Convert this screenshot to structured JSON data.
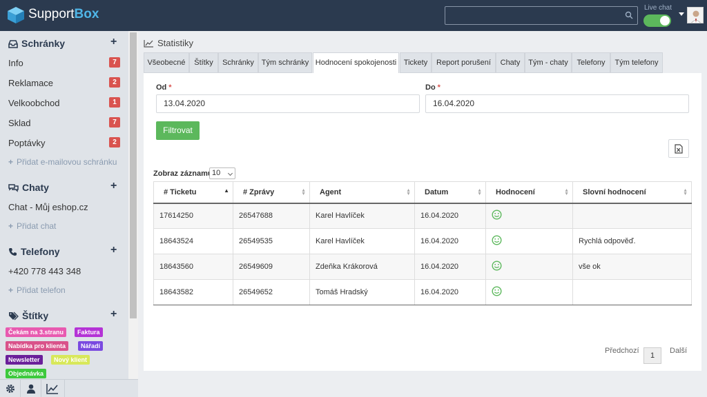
{
  "app": {
    "name_part1": "Support",
    "name_part2": "Box"
  },
  "header": {
    "livechat_label": "Live chat",
    "livechat_on": true,
    "search_placeholder": ""
  },
  "sidebar": {
    "sections": {
      "mailboxes": {
        "title": "Schránky",
        "items": [
          {
            "label": "Info",
            "count": "7"
          },
          {
            "label": "Reklamace",
            "count": "2"
          },
          {
            "label": "Velkoobchod",
            "count": "1"
          },
          {
            "label": "Sklad",
            "count": "7"
          },
          {
            "label": "Poptávky",
            "count": "2"
          }
        ],
        "add_label": "Přidat e-mailovou schránku"
      },
      "chats": {
        "title": "Chaty",
        "items": [
          {
            "label": "Chat - Můj eshop.cz"
          }
        ],
        "add_label": "Přidat chat"
      },
      "phones": {
        "title": "Telefony",
        "items": [
          {
            "label": "+420 778 443 348"
          }
        ],
        "add_label": "Přidat telefon"
      },
      "tags": {
        "title": "Štítky",
        "items": [
          {
            "label": "Čekám na 3.stranu",
            "color": "#e85ab0"
          },
          {
            "label": "Faktura",
            "color": "#b433d6"
          },
          {
            "label": "Nabídka pro klienta",
            "color": "#d9538a"
          },
          {
            "label": "Nářadí",
            "color": "#7a4ae0"
          },
          {
            "label": "Newsletter",
            "color": "#6a1f9a"
          },
          {
            "label": "Nový klient",
            "color": "#d8e85a"
          },
          {
            "label": "Objednávka",
            "color": "#3dc93d"
          }
        ]
      }
    }
  },
  "page": {
    "title": "Statistiky"
  },
  "tabs": [
    {
      "label": "Všeobecné"
    },
    {
      "label": "Štítky"
    },
    {
      "label": "Schránky"
    },
    {
      "label": "Tým schránky"
    },
    {
      "label": "Hodnocení spokojenosti",
      "active": true
    },
    {
      "label": "Tickety"
    },
    {
      "label": "Report porušení"
    },
    {
      "label": "Chaty"
    },
    {
      "label": "Tým - chaty"
    },
    {
      "label": "Telefony"
    },
    {
      "label": "Tým telefony"
    }
  ],
  "filter": {
    "from_label": "Od",
    "from_value": "13.04.2020",
    "to_label": "Do",
    "to_value": "16.04.2020",
    "required_mark": "*",
    "button_label": "Filtrovat"
  },
  "table": {
    "length_label": "Zobraz záznamů",
    "length_value": "10",
    "columns": [
      "# Ticketu",
      "# Zprávy",
      "Agent",
      "Datum",
      "Hodnocení",
      "Slovní hodnocení"
    ],
    "rows": [
      {
        "ticket": "17614250",
        "message": "26547688",
        "agent": "Karel Havlíček",
        "date": "16.04.2020",
        "rating": "smile",
        "comment": ""
      },
      {
        "ticket": "18643524",
        "message": "26549535",
        "agent": "Karel Havlíček",
        "date": "16.04.2020",
        "rating": "smile",
        "comment": "Rychlá odpověď."
      },
      {
        "ticket": "18643560",
        "message": "26549609",
        "agent": "Zdeňka Krákorová",
        "date": "16.04.2020",
        "rating": "smile",
        "comment": "vše ok"
      },
      {
        "ticket": "18643582",
        "message": "26549652",
        "agent": "Tomáš Hradský",
        "date": "16.04.2020",
        "rating": "smile",
        "comment": ""
      }
    ],
    "pagination": {
      "prev": "Předchozí",
      "current": "1",
      "next": "Další"
    }
  },
  "colors": {
    "topbar": "#2b3a4f",
    "brand_accent": "#4fb6e8",
    "badge": "#d9534f",
    "primary_button": "#5cb85c",
    "rating_icon": "#5cb85c"
  }
}
